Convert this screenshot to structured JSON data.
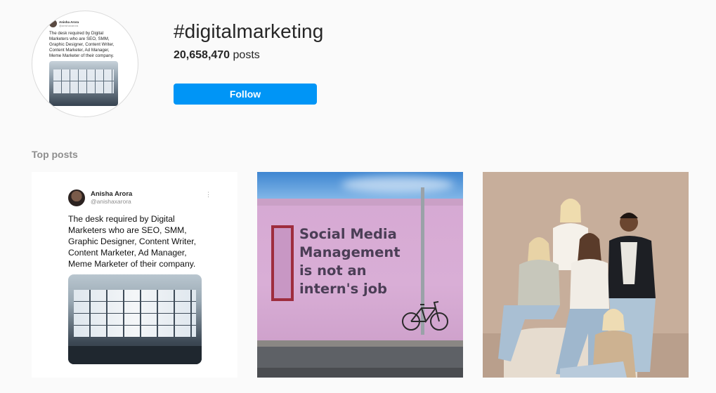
{
  "header": {
    "hashtag": "#digitalmarketing",
    "post_count": "20,658,470",
    "post_suffix": " posts",
    "follow_label": "Follow"
  },
  "avatar_preview": {
    "name": "Anisha Arora",
    "handle": "@anishaxarora",
    "text": "The desk required by Digital Marketers who are SEO, SMM, Graphic Designer, Content Writer, Content Marketer, Ad Manager, Meme Marketer of their company."
  },
  "section_title": "Top posts",
  "posts": [
    {
      "kind": "tweet",
      "name": "Anisha Arora",
      "handle": "@anishaxarora",
      "more": "⋮",
      "text": "The desk required by Digital Marketers who are SEO, SMM, Graphic Designer, Content Writer, Content Marketer, Ad Manager, Meme Marketer of their company."
    },
    {
      "kind": "photo",
      "wall_lines": [
        "Social Media",
        "Management",
        "is not an",
        "intern's job"
      ]
    },
    {
      "kind": "photo"
    }
  ],
  "colors": {
    "background": "#fafafa",
    "accent": "#0095f6",
    "muted": "#8e8e8e"
  }
}
